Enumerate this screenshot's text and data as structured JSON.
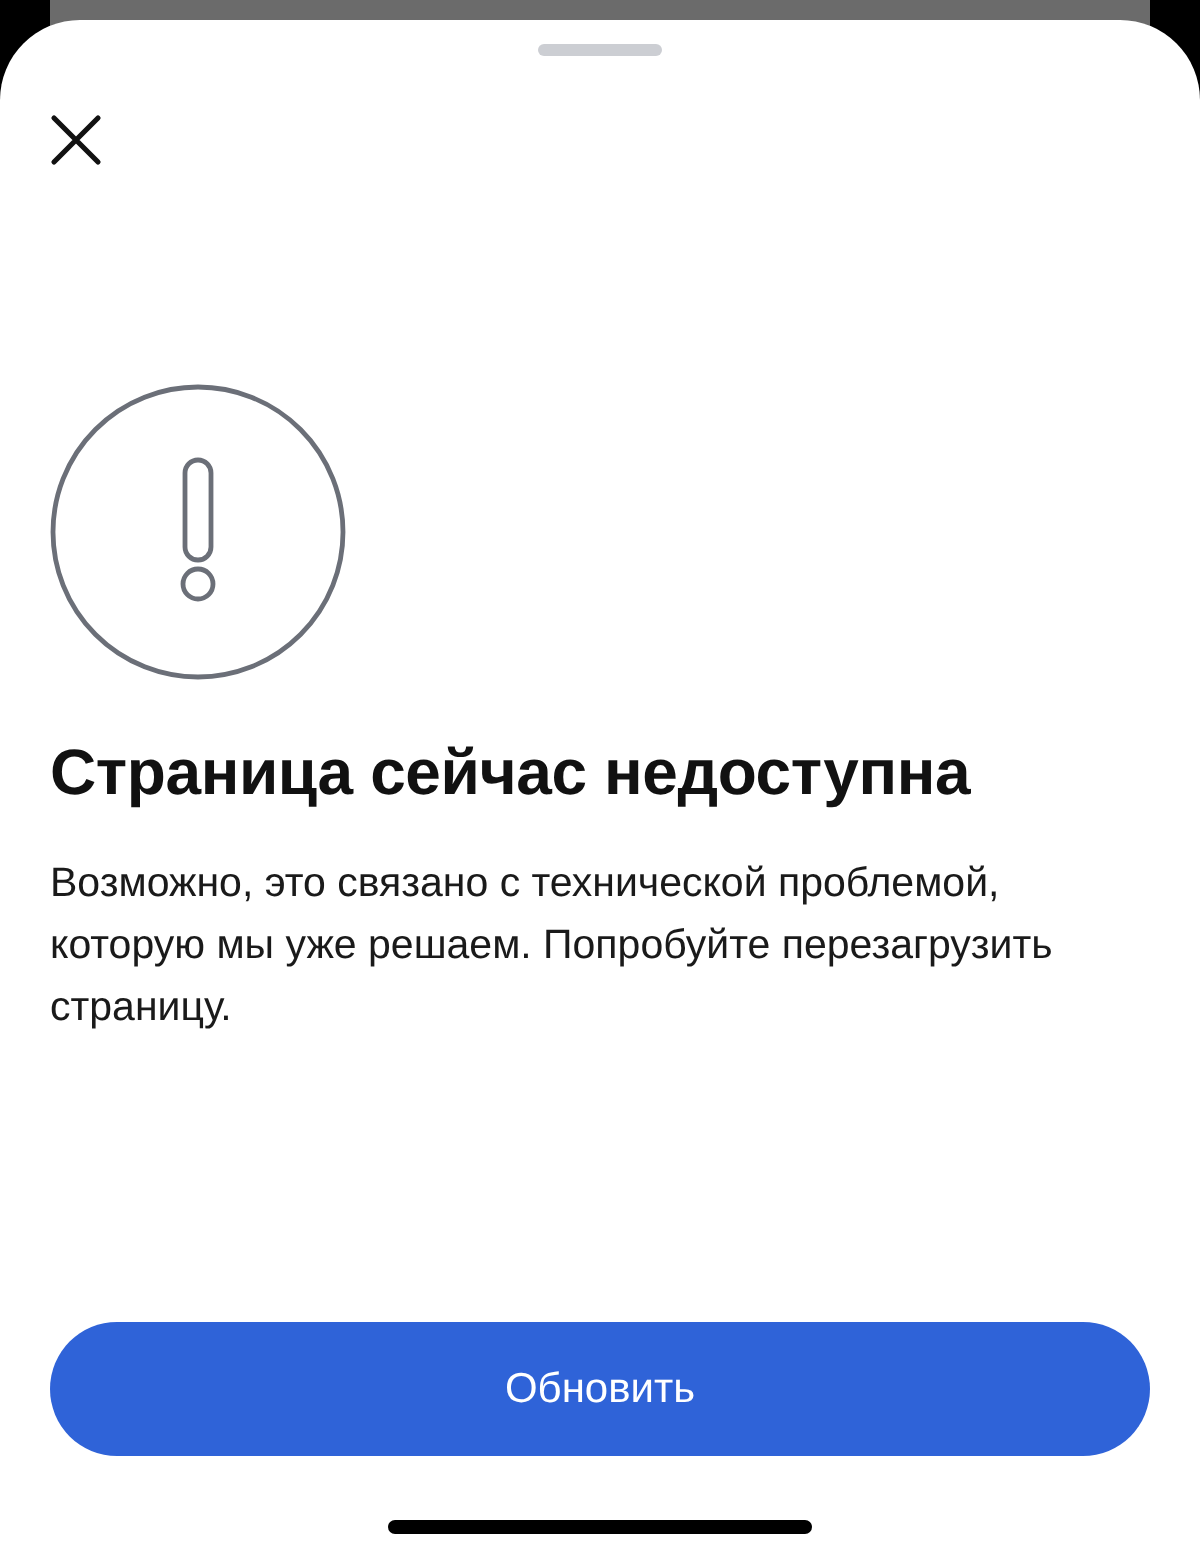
{
  "sheet": {
    "title": "Страница сейчас недоступна",
    "message": "Возможно, это связано с технической проблемой, которую мы уже решаем. Попробуйте перезагрузить страницу.",
    "button": "Обновить"
  }
}
